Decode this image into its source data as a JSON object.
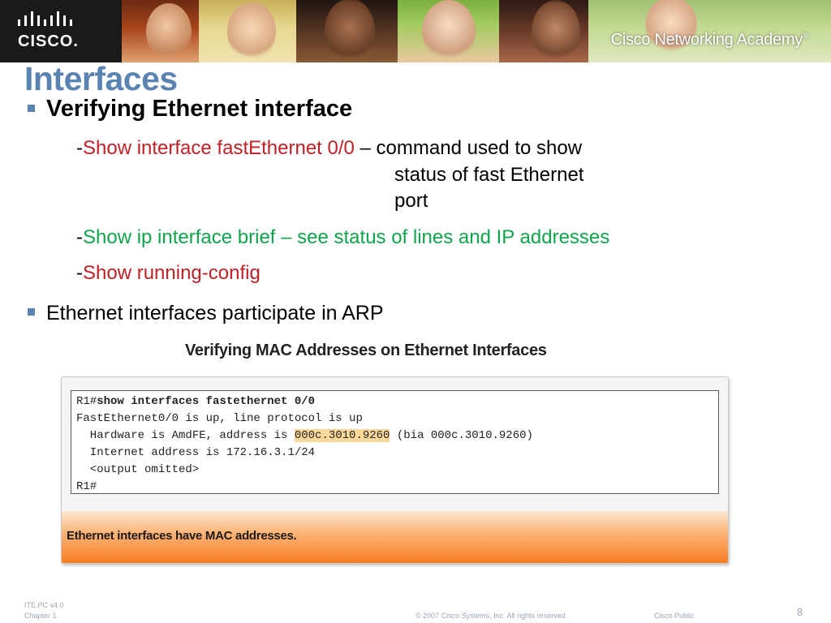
{
  "banner": {
    "logo_text": "CISCO.",
    "academy_text": "Cisco Networking Academy",
    "academy_mark": "®"
  },
  "slide": {
    "title": "Interfaces",
    "bullet1": "Verifying Ethernet interface",
    "sub1": {
      "dash": "-",
      "command": "Show interface fastEthernet 0/0",
      "desc_line1": " – command used to show",
      "desc_line2": "status of fast Ethernet",
      "desc_line3": "port"
    },
    "sub2": {
      "dash": "-",
      "text": "Show ip interface brief – see status of lines and IP addresses"
    },
    "sub3": {
      "dash": "-",
      "text": "Show running-config"
    },
    "bullet2": "Ethernet interfaces participate in ARP"
  },
  "figure": {
    "caption": "Verifying MAC Addresses on Ethernet Interfaces",
    "terminal": {
      "line1_prompt": "R1#",
      "line1_cmd": "show interfaces fastethernet 0/0",
      "line2": "FastEthernet0/0 is up, line protocol is up",
      "line3_pre": "  Hardware is AmdFE, address is ",
      "line3_mac": "000c.3010.9260",
      "line3_post": " (bia 000c.3010.9260)",
      "line4": "  Internet address is 172.16.3.1/24",
      "line5": "  <output omitted>",
      "line6": "R1#"
    },
    "note": "Ethernet interfaces have MAC addresses."
  },
  "footer": {
    "line1": "ITE PC v4.0",
    "line2": "Chapter 1",
    "copyright": "© 2007 Cisco Systems, Inc. All rights reserved.",
    "classification": "Cisco Public",
    "page": "8"
  },
  "colors": {
    "title_blue": "#5a83b2",
    "command_red": "#c02026",
    "brief_green": "#0ea44c",
    "mac_highlight": "#fdd898",
    "orange_bar": "#f77b1f"
  }
}
